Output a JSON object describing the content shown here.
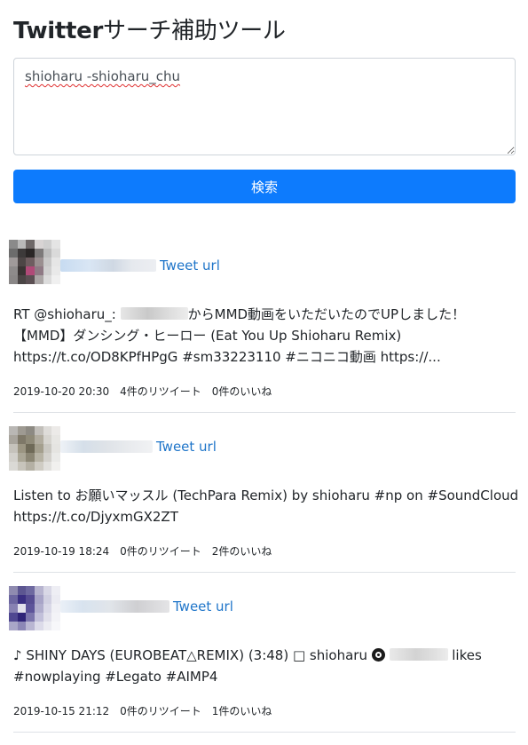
{
  "app": {
    "title_brand": "Twitter",
    "title_rest": "サーチ補助ツール"
  },
  "search": {
    "query": "shioharu -shioharu_chu",
    "button_label": "検索"
  },
  "colors": {
    "primary_button": "#0d7bfd",
    "link": "#1f75c9"
  },
  "tweets": [
    {
      "url_label": "Tweet url",
      "line1_before": "RT @shioharu_: ",
      "line1_after": "からMMD動画をいただいたのでUPしました！",
      "line2": "【MMD】ダンシング・ヒーロー (Eat You Up Shioharu Remix)",
      "line3": "https://t.co/OD8KPfHPgG #sm33223110 #ニコニコ動画 https://...",
      "datetime": "2019-10-20 20:30",
      "retweets": "4件のリツイート",
      "likes": "0件のいいね"
    },
    {
      "url_label": "Tweet url",
      "line1": "Listen to お願いマッスル (TechPara Remix) by shioharu #np on #SoundCloud",
      "line2": "https://t.co/DjyxmGX2ZT",
      "datetime": "2019-10-19 18:24",
      "retweets": "0件のリツイート",
      "likes": "2件のいいね"
    },
    {
      "url_label": "Tweet url",
      "line1_before": "♪ SHINY DAYS (EUROBEAT△REMIX) (3:48) □ shioharu ",
      "line1_icon": "music-disc-icon",
      "line1_after": " likes",
      "line2": "#nowplaying #Legato #AIMP4",
      "datetime": "2019-10-15 21:12",
      "retweets": "0件のリツイート",
      "likes": "1件のいいね"
    }
  ]
}
